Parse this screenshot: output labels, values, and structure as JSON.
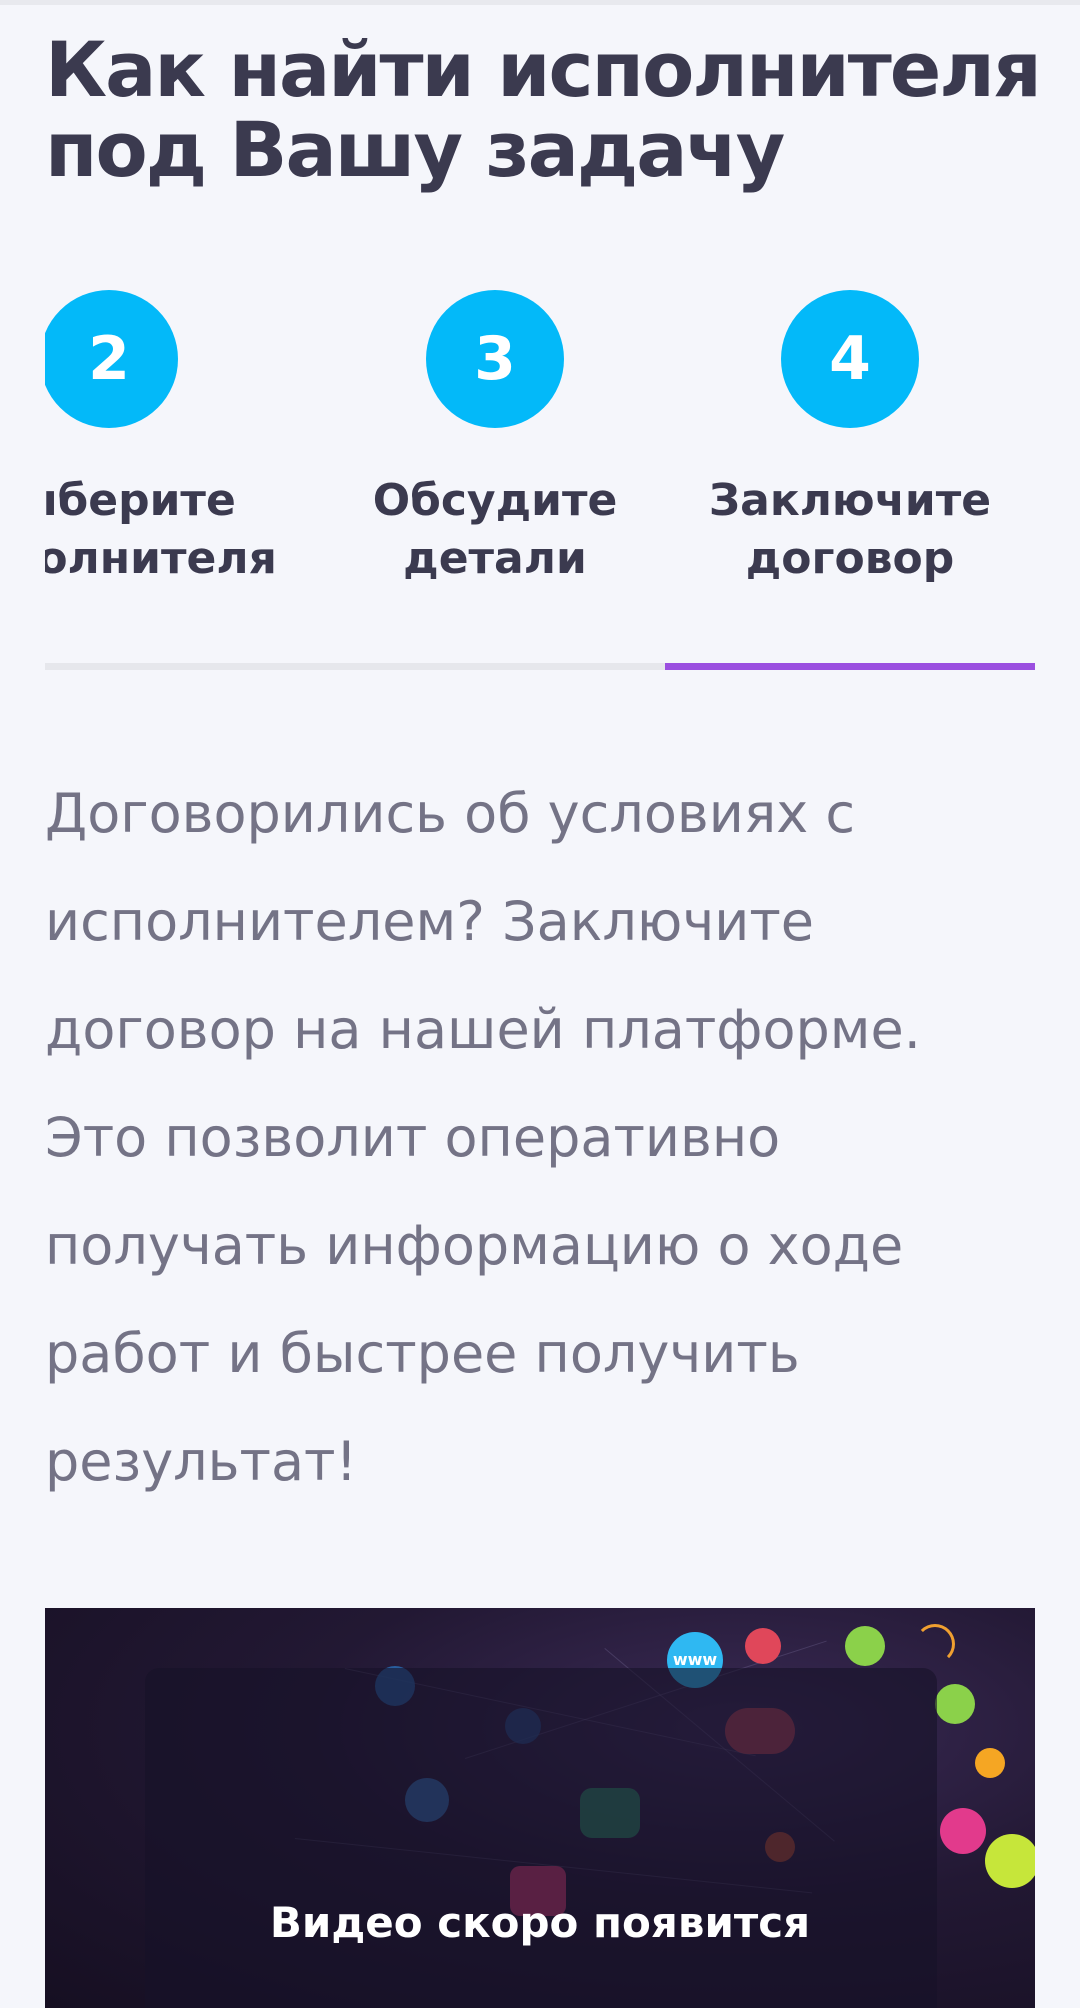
{
  "page": {
    "title": "Как найти исполнителя под Вашу задачу"
  },
  "steps": [
    {
      "number": "2",
      "label": "Выберите\nисполнителя",
      "active": false
    },
    {
      "number": "3",
      "label": "Обсудите\nдетали",
      "active": false
    },
    {
      "number": "4",
      "label": "Заключите\nдоговор",
      "active": true
    }
  ],
  "description": "Договорились об условиях с исполнителем? Заключите договор на нашей платформе. Это позволит оперативно получать информацию о ходе работ и быстрее получить результат!",
  "video": {
    "caption": "Видео скоро появится",
    "www_label": "www"
  },
  "colors": {
    "step_circle": "#03b9f9",
    "active_tab_underline": "#9b4fe0",
    "title_text": "#3b3a4f",
    "body_text": "#747386",
    "background": "#f5f6fb"
  }
}
